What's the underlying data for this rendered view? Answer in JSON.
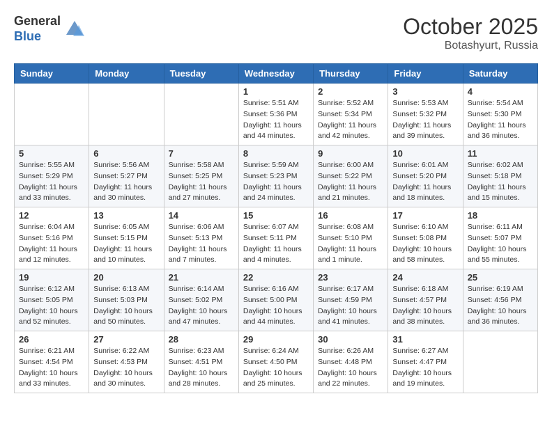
{
  "header": {
    "logo_general": "General",
    "logo_blue": "Blue",
    "month": "October 2025",
    "location": "Botashyurt, Russia"
  },
  "days_of_week": [
    "Sunday",
    "Monday",
    "Tuesday",
    "Wednesday",
    "Thursday",
    "Friday",
    "Saturday"
  ],
  "weeks": [
    [
      {
        "day": "",
        "info": ""
      },
      {
        "day": "",
        "info": ""
      },
      {
        "day": "",
        "info": ""
      },
      {
        "day": "1",
        "info": "Sunrise: 5:51 AM\nSunset: 5:36 PM\nDaylight: 11 hours\nand 44 minutes."
      },
      {
        "day": "2",
        "info": "Sunrise: 5:52 AM\nSunset: 5:34 PM\nDaylight: 11 hours\nand 42 minutes."
      },
      {
        "day": "3",
        "info": "Sunrise: 5:53 AM\nSunset: 5:32 PM\nDaylight: 11 hours\nand 39 minutes."
      },
      {
        "day": "4",
        "info": "Sunrise: 5:54 AM\nSunset: 5:30 PM\nDaylight: 11 hours\nand 36 minutes."
      }
    ],
    [
      {
        "day": "5",
        "info": "Sunrise: 5:55 AM\nSunset: 5:29 PM\nDaylight: 11 hours\nand 33 minutes."
      },
      {
        "day": "6",
        "info": "Sunrise: 5:56 AM\nSunset: 5:27 PM\nDaylight: 11 hours\nand 30 minutes."
      },
      {
        "day": "7",
        "info": "Sunrise: 5:58 AM\nSunset: 5:25 PM\nDaylight: 11 hours\nand 27 minutes."
      },
      {
        "day": "8",
        "info": "Sunrise: 5:59 AM\nSunset: 5:23 PM\nDaylight: 11 hours\nand 24 minutes."
      },
      {
        "day": "9",
        "info": "Sunrise: 6:00 AM\nSunset: 5:22 PM\nDaylight: 11 hours\nand 21 minutes."
      },
      {
        "day": "10",
        "info": "Sunrise: 6:01 AM\nSunset: 5:20 PM\nDaylight: 11 hours\nand 18 minutes."
      },
      {
        "day": "11",
        "info": "Sunrise: 6:02 AM\nSunset: 5:18 PM\nDaylight: 11 hours\nand 15 minutes."
      }
    ],
    [
      {
        "day": "12",
        "info": "Sunrise: 6:04 AM\nSunset: 5:16 PM\nDaylight: 11 hours\nand 12 minutes."
      },
      {
        "day": "13",
        "info": "Sunrise: 6:05 AM\nSunset: 5:15 PM\nDaylight: 11 hours\nand 10 minutes."
      },
      {
        "day": "14",
        "info": "Sunrise: 6:06 AM\nSunset: 5:13 PM\nDaylight: 11 hours\nand 7 minutes."
      },
      {
        "day": "15",
        "info": "Sunrise: 6:07 AM\nSunset: 5:11 PM\nDaylight: 11 hours\nand 4 minutes."
      },
      {
        "day": "16",
        "info": "Sunrise: 6:08 AM\nSunset: 5:10 PM\nDaylight: 11 hours\nand 1 minute."
      },
      {
        "day": "17",
        "info": "Sunrise: 6:10 AM\nSunset: 5:08 PM\nDaylight: 10 hours\nand 58 minutes."
      },
      {
        "day": "18",
        "info": "Sunrise: 6:11 AM\nSunset: 5:07 PM\nDaylight: 10 hours\nand 55 minutes."
      }
    ],
    [
      {
        "day": "19",
        "info": "Sunrise: 6:12 AM\nSunset: 5:05 PM\nDaylight: 10 hours\nand 52 minutes."
      },
      {
        "day": "20",
        "info": "Sunrise: 6:13 AM\nSunset: 5:03 PM\nDaylight: 10 hours\nand 50 minutes."
      },
      {
        "day": "21",
        "info": "Sunrise: 6:14 AM\nSunset: 5:02 PM\nDaylight: 10 hours\nand 47 minutes."
      },
      {
        "day": "22",
        "info": "Sunrise: 6:16 AM\nSunset: 5:00 PM\nDaylight: 10 hours\nand 44 minutes."
      },
      {
        "day": "23",
        "info": "Sunrise: 6:17 AM\nSunset: 4:59 PM\nDaylight: 10 hours\nand 41 minutes."
      },
      {
        "day": "24",
        "info": "Sunrise: 6:18 AM\nSunset: 4:57 PM\nDaylight: 10 hours\nand 38 minutes."
      },
      {
        "day": "25",
        "info": "Sunrise: 6:19 AM\nSunset: 4:56 PM\nDaylight: 10 hours\nand 36 minutes."
      }
    ],
    [
      {
        "day": "26",
        "info": "Sunrise: 6:21 AM\nSunset: 4:54 PM\nDaylight: 10 hours\nand 33 minutes."
      },
      {
        "day": "27",
        "info": "Sunrise: 6:22 AM\nSunset: 4:53 PM\nDaylight: 10 hours\nand 30 minutes."
      },
      {
        "day": "28",
        "info": "Sunrise: 6:23 AM\nSunset: 4:51 PM\nDaylight: 10 hours\nand 28 minutes."
      },
      {
        "day": "29",
        "info": "Sunrise: 6:24 AM\nSunset: 4:50 PM\nDaylight: 10 hours\nand 25 minutes."
      },
      {
        "day": "30",
        "info": "Sunrise: 6:26 AM\nSunset: 4:48 PM\nDaylight: 10 hours\nand 22 minutes."
      },
      {
        "day": "31",
        "info": "Sunrise: 6:27 AM\nSunset: 4:47 PM\nDaylight: 10 hours\nand 19 minutes."
      },
      {
        "day": "",
        "info": ""
      }
    ]
  ]
}
